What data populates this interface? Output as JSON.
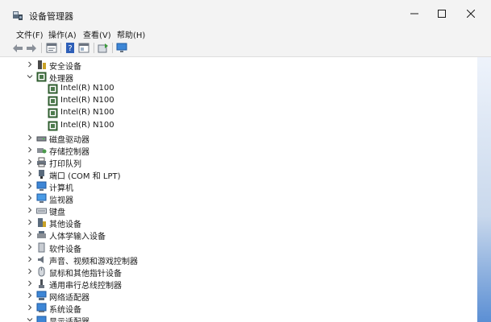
{
  "window": {
    "title": "设备管理器"
  },
  "menu": [
    {
      "label": "文件(F)"
    },
    {
      "label": "操作(A)"
    },
    {
      "label": "查看(V)"
    },
    {
      "label": "帮助(H)"
    }
  ],
  "toolbar": [
    "back-arrow-icon",
    "forward-arrow-icon",
    "properties-icon",
    "help-icon",
    "details-icon",
    "update-driver-icon",
    "monitor-icon"
  ],
  "tree": [
    {
      "label": "安全设备",
      "state": "collapsed",
      "level": 0,
      "icon": "security-device-icon"
    },
    {
      "label": "处理器",
      "state": "expanded",
      "level": 0,
      "icon": "processor-icon"
    },
    {
      "label": "Intel(R) N100",
      "state": "leaf",
      "level": 1,
      "icon": "processor-icon"
    },
    {
      "label": "Intel(R) N100",
      "state": "leaf",
      "level": 1,
      "icon": "processor-icon"
    },
    {
      "label": "Intel(R) N100",
      "state": "leaf",
      "level": 1,
      "icon": "processor-icon"
    },
    {
      "label": "Intel(R) N100",
      "state": "leaf",
      "level": 1,
      "icon": "processor-icon"
    },
    {
      "label": "磁盘驱动器",
      "state": "collapsed",
      "level": 0,
      "icon": "disk-drive-icon"
    },
    {
      "label": "存储控制器",
      "state": "collapsed",
      "level": 0,
      "icon": "storage-controller-icon"
    },
    {
      "label": "打印队列",
      "state": "collapsed",
      "level": 0,
      "icon": "printer-icon"
    },
    {
      "label": "端口 (COM 和 LPT)",
      "state": "collapsed",
      "level": 0,
      "icon": "port-icon"
    },
    {
      "label": "计算机",
      "state": "collapsed",
      "level": 0,
      "icon": "computer-icon"
    },
    {
      "label": "监视器",
      "state": "collapsed",
      "level": 0,
      "icon": "monitor-icon"
    },
    {
      "label": "键盘",
      "state": "collapsed",
      "level": 0,
      "icon": "keyboard-icon"
    },
    {
      "label": "其他设备",
      "state": "collapsed",
      "level": 0,
      "icon": "other-device-icon"
    },
    {
      "label": "人体学输入设备",
      "state": "collapsed",
      "level": 0,
      "icon": "hid-icon"
    },
    {
      "label": "软件设备",
      "state": "collapsed",
      "level": 0,
      "icon": "software-device-icon"
    },
    {
      "label": "声音、视频和游戏控制器",
      "state": "collapsed",
      "level": 0,
      "icon": "speaker-icon"
    },
    {
      "label": "鼠标和其他指针设备",
      "state": "collapsed",
      "level": 0,
      "icon": "mouse-icon"
    },
    {
      "label": "通用串行总线控制器",
      "state": "collapsed",
      "level": 0,
      "icon": "usb-icon"
    },
    {
      "label": "网络适配器",
      "state": "collapsed",
      "level": 0,
      "icon": "network-adapter-icon"
    },
    {
      "label": "系统设备",
      "state": "collapsed",
      "level": 0,
      "icon": "system-device-icon"
    },
    {
      "label": "显示适配器",
      "state": "expanded",
      "level": 0,
      "icon": "display-adapter-icon"
    }
  ]
}
